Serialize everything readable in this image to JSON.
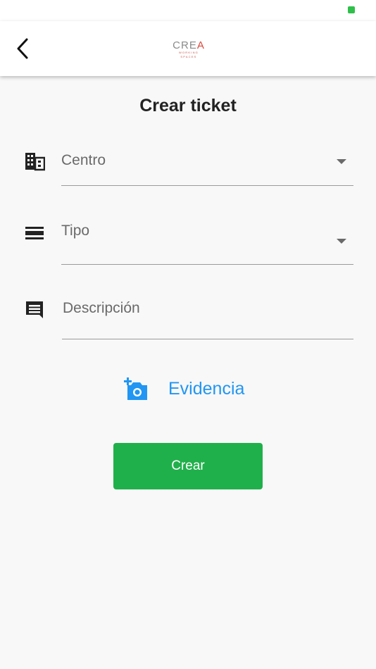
{
  "status_bar": {
    "indicator_color": "#2ec04a"
  },
  "app_bar": {
    "back_icon": "chevron-left-icon",
    "logo": {
      "text_primary": "CRE",
      "text_accent": "A",
      "subtitle": "WORKING SPACES"
    }
  },
  "page": {
    "title": "Crear ticket"
  },
  "form": {
    "centro": {
      "label": "Centro",
      "icon": "building-icon"
    },
    "tipo": {
      "label": "Tipo",
      "icon": "list-lines-icon"
    },
    "descripcion": {
      "label": "Descripción",
      "icon": "comment-icon"
    },
    "evidencia": {
      "label": "Evidencia",
      "icon": "add-photo-icon"
    },
    "submit": {
      "label": "Crear"
    }
  },
  "colors": {
    "accent": "#2196f3",
    "primary_button": "#20b04b",
    "logo_accent": "#d8483b"
  }
}
